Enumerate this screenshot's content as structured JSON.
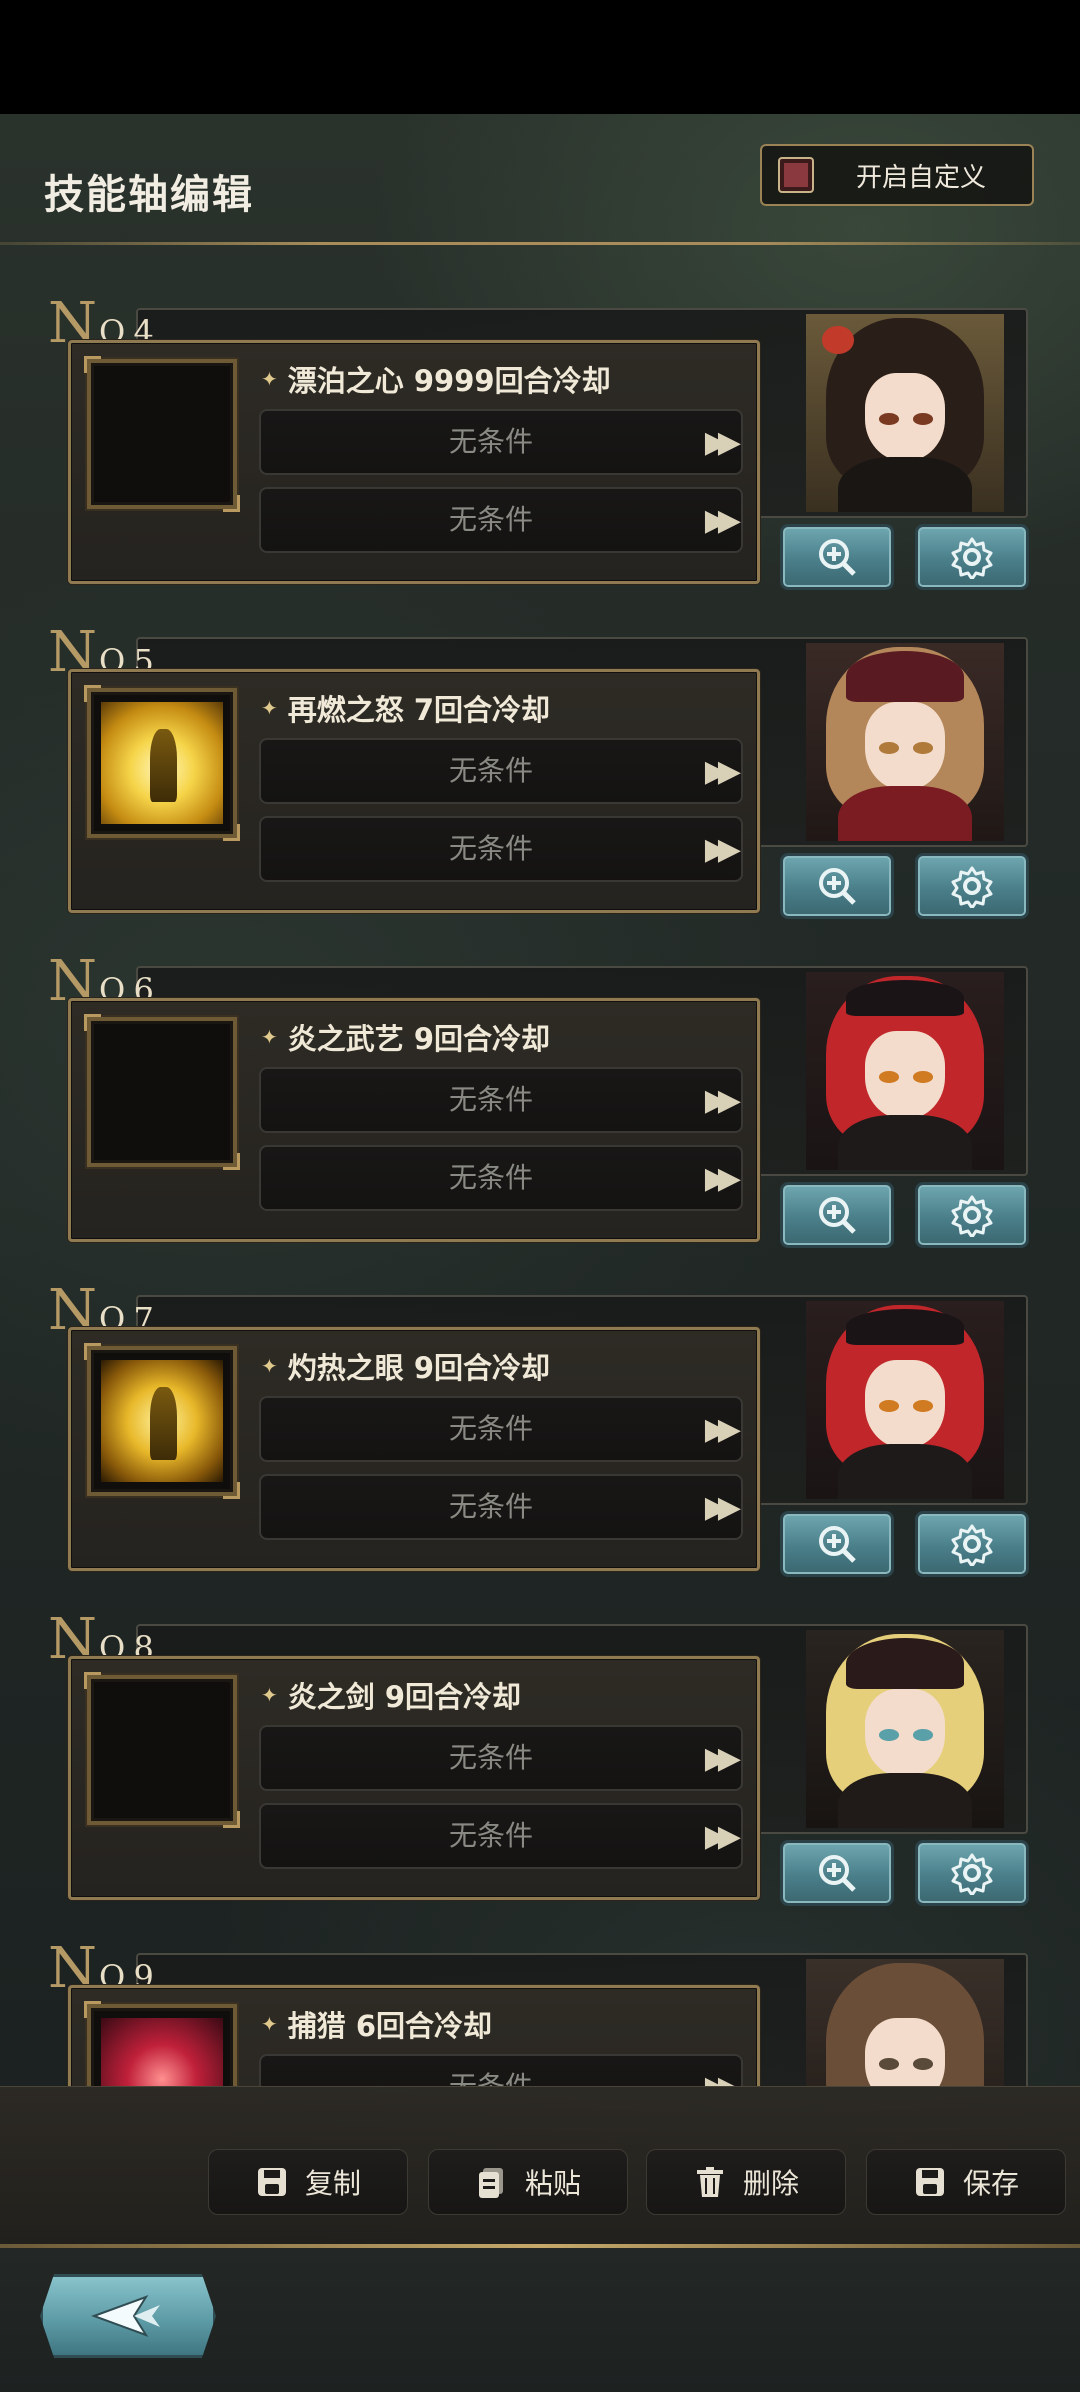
{
  "header": {
    "title": "技能轴编辑",
    "custom_toggle_label": "开启自定义"
  },
  "entries": [
    {
      "no_prefix": "N",
      "no_number": "O.4",
      "skill": "漂泊之心 9999回合冷却",
      "conditions": [
        "无条件",
        "无条件"
      ],
      "icon": "empty",
      "portrait": "dark-haired-woman"
    },
    {
      "no_prefix": "N",
      "no_number": "O.5",
      "skill": "再燃之怒 7回合冷却",
      "conditions": [
        "无条件",
        "无条件"
      ],
      "icon": "golden-warrior-skill",
      "portrait": "blonde-girl-red-hood"
    },
    {
      "no_prefix": "N",
      "no_number": "O.6",
      "skill": "炎之武艺 9回合冷却",
      "conditions": [
        "无条件",
        "无条件"
      ],
      "icon": "empty",
      "portrait": "red-haired-masked-boy"
    },
    {
      "no_prefix": "N",
      "no_number": "O.7",
      "skill": "灼热之眼 9回合冷却",
      "conditions": [
        "无条件",
        "无条件"
      ],
      "icon": "golden-flame-skill",
      "portrait": "red-haired-masked-boy"
    },
    {
      "no_prefix": "N",
      "no_number": "O.8",
      "skill": "炎之剑 9回合冷却",
      "conditions": [
        "无条件",
        "无条件"
      ],
      "icon": "empty",
      "portrait": "blonde-girl-military-cap"
    },
    {
      "no_prefix": "N",
      "no_number": "O.9",
      "skill": "捕猎 6回合冷却",
      "conditions": [
        "无条件"
      ],
      "icon": "red-lightning-skill",
      "portrait": "brown-haired-girl"
    }
  ],
  "actions": {
    "copy": "复制",
    "paste": "粘贴",
    "delete": "删除",
    "save": "保存"
  },
  "colors": {
    "gold_border": "#8f7a52",
    "teal_button": "#4a7f8a",
    "condition_text": "#8a8a84"
  }
}
